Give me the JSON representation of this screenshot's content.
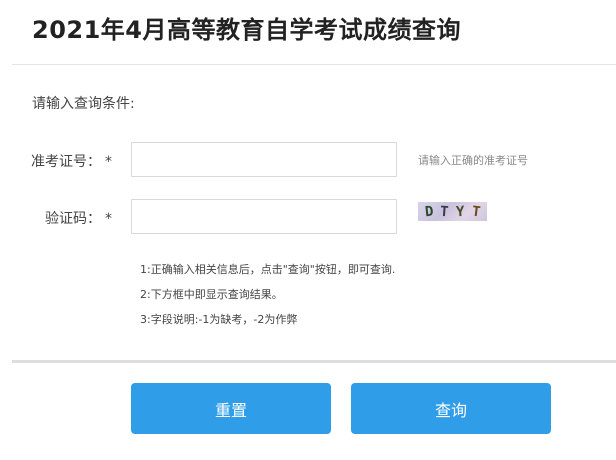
{
  "page": {
    "title": "2021年4月高等教育自学考试成绩查询",
    "prompt": "请输入查询条件:"
  },
  "form": {
    "required_mark": "*",
    "exam_id": {
      "label": "准考证号：",
      "value": "",
      "hint": "请输入正确的准考证号"
    },
    "captcha": {
      "label": "验证码：",
      "value": "",
      "image_text": [
        "D",
        "T",
        "Y",
        "T"
      ],
      "image_colors": [
        "#2a4a2a",
        "#3a3a4a",
        "#4a4a2a",
        "#6b4a1a"
      ]
    }
  },
  "notes": [
    "1:正确输入相关信息后，点击\"查询\"按钮，即可查询.",
    "2:下方框中即显示查询结果。",
    "3:字段说明:-1为缺考，-2为作弊"
  ],
  "buttons": {
    "reset_label": "重置",
    "query_label": "查询",
    "color": "#2f9de8"
  }
}
